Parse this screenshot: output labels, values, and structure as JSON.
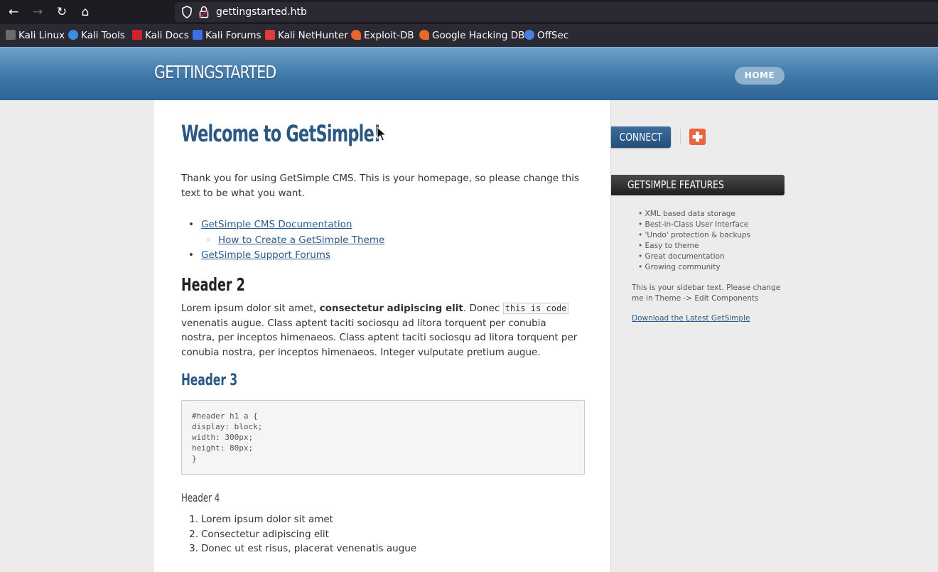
{
  "browser": {
    "url": "gettingstarted.htb",
    "bookmarks": [
      {
        "label": "Kali Linux",
        "color": "#6b6b6b"
      },
      {
        "label": "Kali Tools",
        "color": "#3c8ce7"
      },
      {
        "label": "Kali Docs",
        "color": "#d6202e"
      },
      {
        "label": "Kali Forums",
        "color": "#3c6fe7"
      },
      {
        "label": "Kali NetHunter",
        "color": "#e23a3a"
      },
      {
        "label": "Exploit-DB",
        "color": "#e8682a"
      },
      {
        "label": "Google Hacking DB",
        "color": "#e8682a"
      },
      {
        "label": "OffSec",
        "color": "#4a7fe0"
      }
    ]
  },
  "header": {
    "site_title": "GETTINGSTARTED",
    "home_label": "HOME"
  },
  "content": {
    "title": "Welcome to GetSimple!",
    "intro": "Thank you for using GetSimple CMS. This is your homepage, so please change this text to be what you want.",
    "links": {
      "doc": "GetSimple CMS Documentation",
      "theme": "How to Create a GetSimple Theme",
      "forums": "GetSimple Support Forums"
    },
    "h2": "Header 2",
    "lorem": {
      "pre": "Lorem ipsum dolor sit amet, ",
      "bold": "consectetur adipiscing elit",
      "mid": ". Donec ",
      "code": "this is code",
      "post": " venenatis augue. Class aptent taciti sociosqu ad litora torquent per conubia nostra, per inceptos himenaeos. Class aptent taciti sociosqu ad litora torquent per conubia nostra, per inceptos himenaeos. Integer vulputate pretium augue."
    },
    "h3": "Header 3",
    "code_lines": [
      "#header h1 a {",
      "display: block;",
      "width: 300px;",
      "height: 80px;",
      "}"
    ],
    "h4": "Header 4",
    "ordered": [
      "Lorem ipsum dolor sit amet",
      "Consectetur adipiscing elit",
      "Donec ut est risus, placerat venenatis augue"
    ]
  },
  "sidebar": {
    "connect_label": "CONNECT",
    "features_title": "GETSIMPLE FEATURES",
    "features": [
      "XML based data storage",
      "Best-in-Class User Interface",
      "'Undo' protection & backups",
      "Easy to theme",
      "Great documentation",
      "Growing community"
    ],
    "text": "This is your sidebar text. Please change me in Theme -> Edit Components",
    "download_link": "Download the Latest GetSimple"
  }
}
